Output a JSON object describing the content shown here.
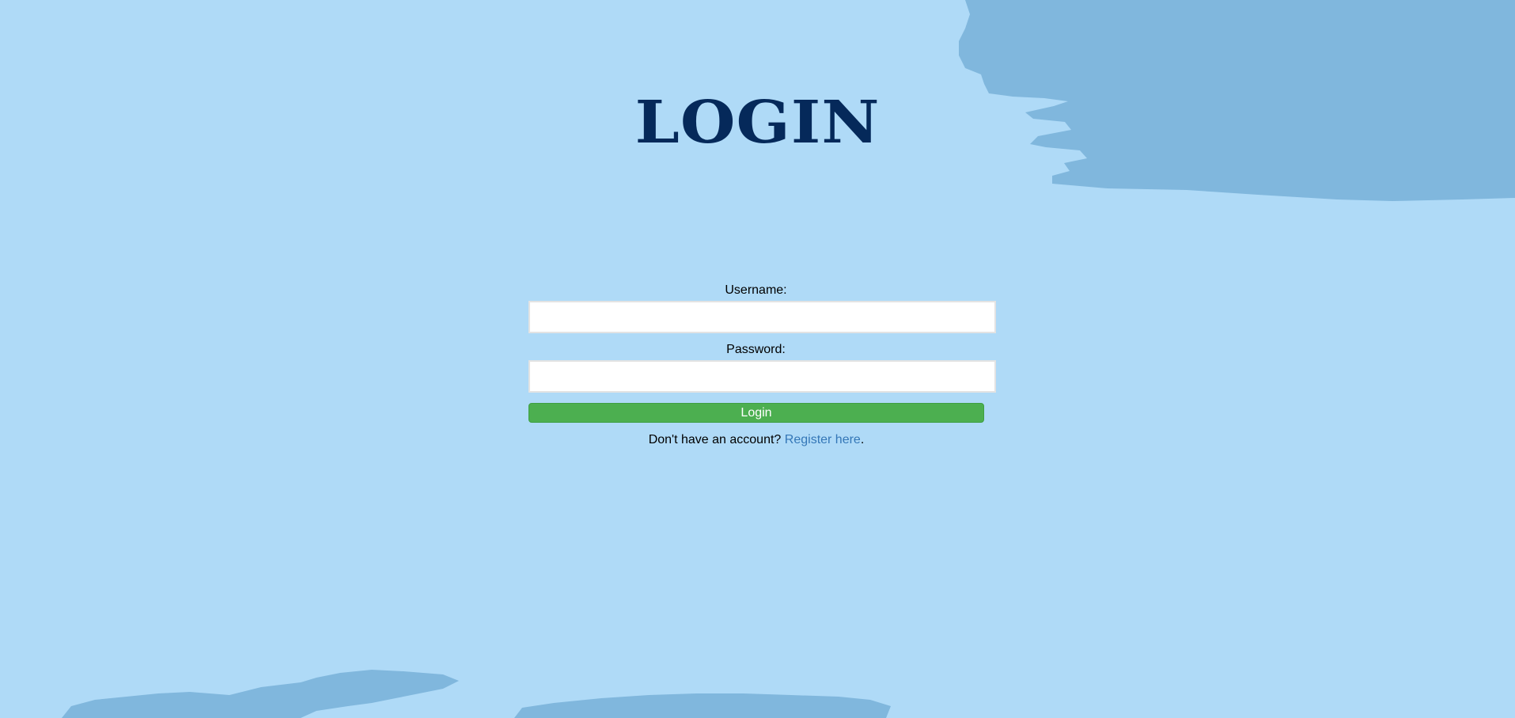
{
  "page": {
    "title": "LOGIN",
    "background_color": "#afdaf7",
    "brush_color": "#80b7dd",
    "title_color": "#05295a"
  },
  "form": {
    "username_label": "Username:",
    "username_value": "",
    "username_placeholder": "",
    "password_label": "Password:",
    "password_value": "",
    "password_placeholder": "",
    "submit_label": "Login",
    "submit_color": "#4caf50"
  },
  "register": {
    "prompt": "Don't have an account?",
    "link_label": "Register here",
    "suffix": ".",
    "link_color": "#3477b7"
  }
}
